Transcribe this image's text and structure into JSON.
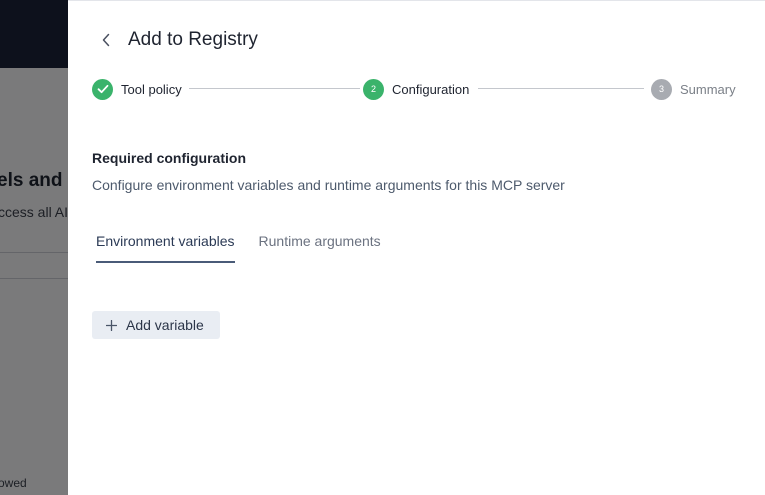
{
  "background": {
    "title_fragment": "els and M",
    "subtitle_fragment": "ccess all AI",
    "footer_fragment": "owed"
  },
  "drawer": {
    "title": "Add to Registry",
    "back_icon": "chevron-left-icon"
  },
  "stepper": {
    "steps": [
      {
        "number": "",
        "label": "Tool policy",
        "status": "completed",
        "icon": "check-icon"
      },
      {
        "number": "2",
        "label": "Configuration",
        "status": "active"
      },
      {
        "number": "3",
        "label": "Summary",
        "status": "pending"
      }
    ]
  },
  "section": {
    "title": "Required configuration",
    "description": "Configure environment variables and runtime arguments for this MCP server"
  },
  "tabs": [
    {
      "label": "Environment variables",
      "active": true
    },
    {
      "label": "Runtime arguments",
      "active": false
    }
  ],
  "actions": {
    "add_variable_label": "Add variable",
    "add_icon": "plus-icon"
  },
  "colors": {
    "step_complete": "#3ab36b",
    "step_active": "#3ab36b",
    "step_pending": "#a8abb1",
    "tab_active": "#2b3a55",
    "topbar": "#1a2338"
  }
}
